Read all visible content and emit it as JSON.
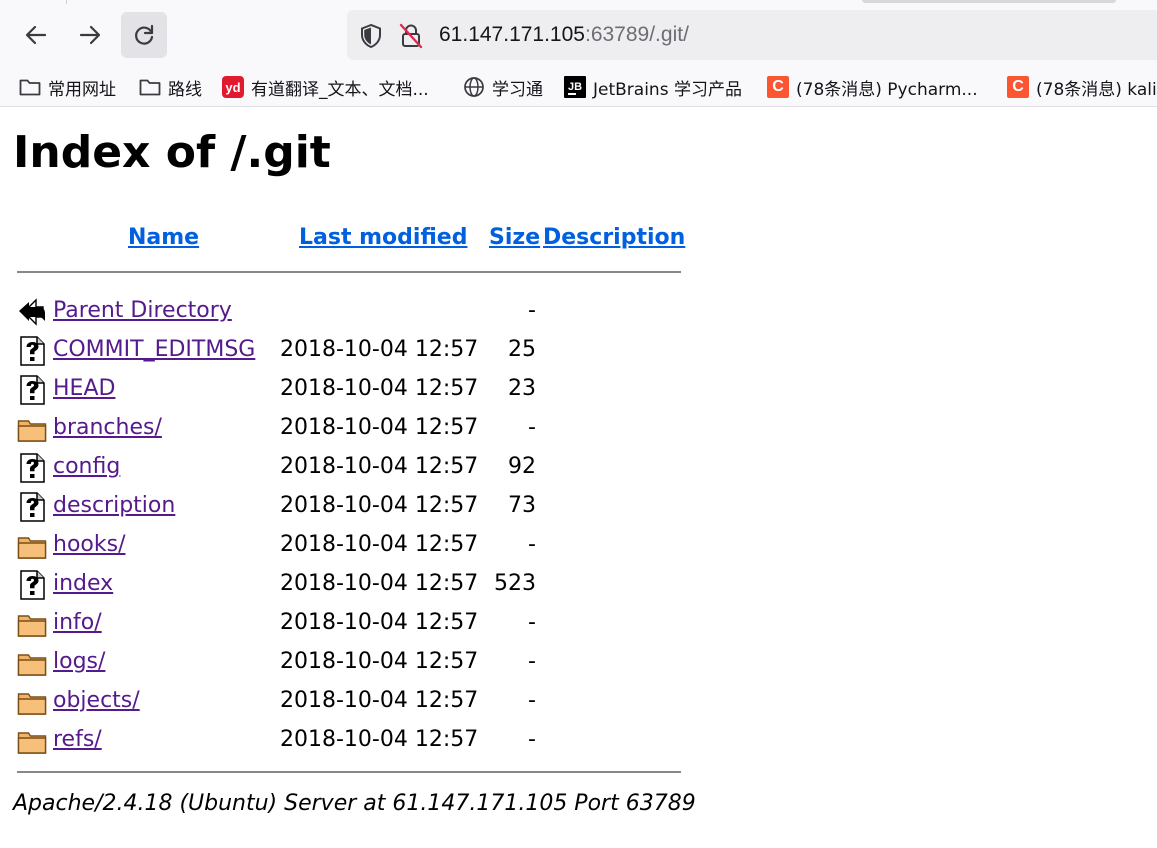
{
  "browser": {
    "url_host": "61.147.171.105",
    "url_rest": ":63789/.git/",
    "bookmarks": [
      {
        "label": "常用网址",
        "icon": "folder-icon"
      },
      {
        "label": "路线",
        "icon": "folder-icon"
      },
      {
        "label": "有道翻译_文本、文档...",
        "icon": "youdao-icon",
        "badge": "yd"
      },
      {
        "label": "学习通",
        "icon": "globe-icon"
      },
      {
        "label": "JetBrains 学习产品",
        "icon": "jetbrains-icon",
        "badge": "JB"
      },
      {
        "label": "(78条消息) Pycharm...",
        "icon": "csdn-icon",
        "badge": "C"
      },
      {
        "label": "(78条消息) kali",
        "icon": "csdn-icon",
        "badge": "C"
      }
    ]
  },
  "page": {
    "title": "Index of /.git",
    "columns": {
      "name": "Name",
      "last_modified": "Last modified",
      "size": "Size",
      "description": "Description"
    },
    "entries": [
      {
        "name": "Parent Directory",
        "modified": "",
        "size": "-",
        "icon": "back-arrow-icon"
      },
      {
        "name": "COMMIT_EDITMSG",
        "modified": "2018-10-04 12:57",
        "size": "25",
        "icon": "unknown-file-icon"
      },
      {
        "name": "HEAD",
        "modified": "2018-10-04 12:57",
        "size": "23",
        "icon": "unknown-file-icon"
      },
      {
        "name": "branches/",
        "modified": "2018-10-04 12:57",
        "size": "-",
        "icon": "folder-icon"
      },
      {
        "name": "config",
        "modified": "2018-10-04 12:57",
        "size": "92",
        "icon": "unknown-file-icon"
      },
      {
        "name": "description",
        "modified": "2018-10-04 12:57",
        "size": "73",
        "icon": "unknown-file-icon"
      },
      {
        "name": "hooks/",
        "modified": "2018-10-04 12:57",
        "size": "-",
        "icon": "folder-icon"
      },
      {
        "name": "index",
        "modified": "2018-10-04 12:57",
        "size": "523",
        "icon": "unknown-file-icon"
      },
      {
        "name": "info/",
        "modified": "2018-10-04 12:57",
        "size": "-",
        "icon": "folder-icon"
      },
      {
        "name": "logs/",
        "modified": "2018-10-04 12:57",
        "size": "-",
        "icon": "folder-icon"
      },
      {
        "name": "objects/",
        "modified": "2018-10-04 12:57",
        "size": "-",
        "icon": "folder-icon"
      },
      {
        "name": "refs/",
        "modified": "2018-10-04 12:57",
        "size": "-",
        "icon": "folder-icon"
      }
    ],
    "footer": "Apache/2.4.18 (Ubuntu) Server at 61.147.171.105 Port 63789"
  }
}
